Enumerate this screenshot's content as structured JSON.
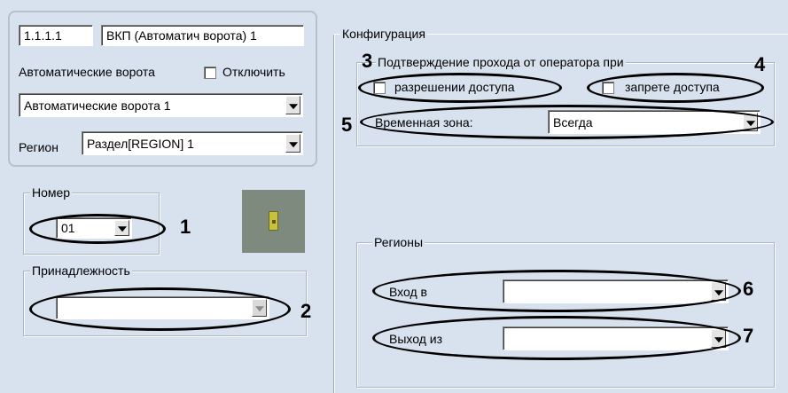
{
  "object": {
    "id": "1.1.1.1",
    "name": "ВКП  (Автоматич ворота) 1",
    "type_label": "Автоматические ворота",
    "disable_label": "Отключить",
    "type_value": "Автоматические ворота 1",
    "region_label": "Регион",
    "region_value": "Раздел[REGION] 1"
  },
  "number": {
    "legend": "Номер",
    "value": "01",
    "callout": "1"
  },
  "belonging": {
    "legend": "Принадлежность",
    "value": "",
    "callout": "2"
  },
  "config": {
    "legend": "Конфигурация",
    "confirm": {
      "legend": "Подтверждение прохода от оператора при",
      "on_grant_label": "разрешении доступа",
      "on_deny_label": "запрете доступа",
      "time_zone_label": "Временная зона:",
      "time_zone_value": "Всегда",
      "callout_grant": "3",
      "callout_deny": "4",
      "callout_timezone": "5"
    },
    "regions": {
      "legend": "Регионы",
      "entry_label": "Вход в",
      "entry_value": "",
      "exit_label": "Выход из",
      "exit_value": "",
      "callout_entry": "6",
      "callout_exit": "7"
    }
  },
  "colors": {
    "background": "#d8e2ee",
    "indicator_tile": "#7e8a7e",
    "indicator_lamp": "#c8c23a"
  }
}
